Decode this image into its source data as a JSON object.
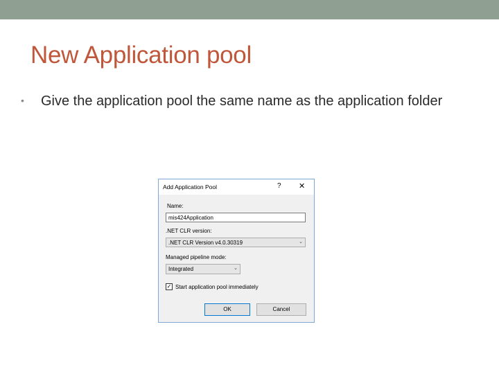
{
  "slide": {
    "title": "New Application pool",
    "bullet": "Give the application pool the same name as the application folder",
    "bullet_marker": "•"
  },
  "dialog": {
    "title": "Add Application Pool",
    "help_glyph": "?",
    "close_glyph": "✕",
    "name_label": "Name:",
    "name_value": "mis424Application",
    "clr_label": ".NET CLR version:",
    "clr_value": ".NET CLR Version v4.0.30319",
    "pipeline_label": "Managed pipeline mode:",
    "pipeline_value": "Integrated",
    "start_label": "Start application pool immediately",
    "start_checked": true,
    "ok_label": "OK",
    "cancel_label": "Cancel"
  },
  "colors": {
    "top_bar": "#8fa092",
    "title": "#c0573a",
    "dialog_border": "#7ea7d8",
    "ok_border": "#0078d7"
  }
}
